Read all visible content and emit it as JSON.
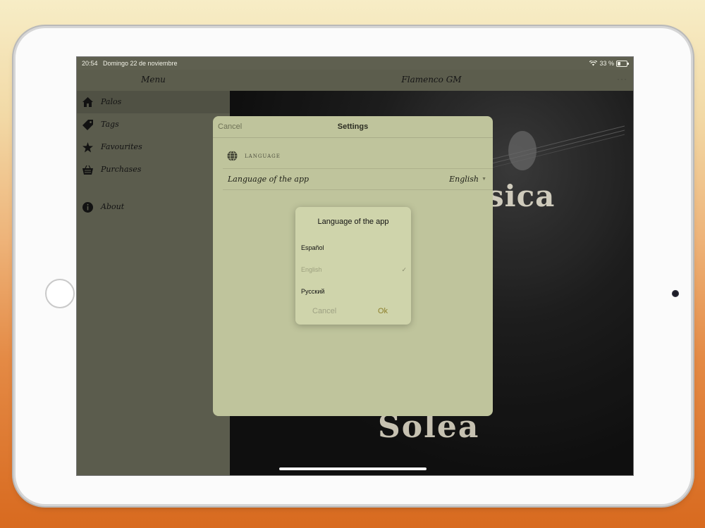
{
  "status_bar": {
    "time": "20:54",
    "date": "Domingo 22 de noviembre",
    "battery": "33 %"
  },
  "nav": {
    "menu_title": "Menu",
    "app_title": "Flamenco GM",
    "more": "···"
  },
  "sidebar": {
    "items": [
      {
        "label": "Palos",
        "icon": "home-icon"
      },
      {
        "label": "Tags",
        "icon": "tag-icon"
      },
      {
        "label": "Favourites",
        "icon": "star-icon"
      },
      {
        "label": "Purchases",
        "icon": "basket-icon"
      },
      {
        "label": "About",
        "icon": "info-icon"
      }
    ]
  },
  "content": {
    "art_text_1": "sica",
    "art_text_2": "Solea"
  },
  "settings": {
    "cancel": "Cancel",
    "title": "Settings",
    "section_label": "LANGUAGE",
    "row_label": "Language of the app",
    "row_value": "English"
  },
  "picker": {
    "title": "Language of the app",
    "options": [
      {
        "label": "Español",
        "selected": false
      },
      {
        "label": "English",
        "selected": true
      },
      {
        "label": "Русский",
        "selected": false
      }
    ],
    "check": "✓",
    "cancel": "Cancel",
    "ok": "Ok"
  },
  "colors": {
    "sidebar": "#5e5f50",
    "modal": "#bfc49c",
    "picker": "#cfd4ab",
    "accent": "#8c7f2a"
  }
}
